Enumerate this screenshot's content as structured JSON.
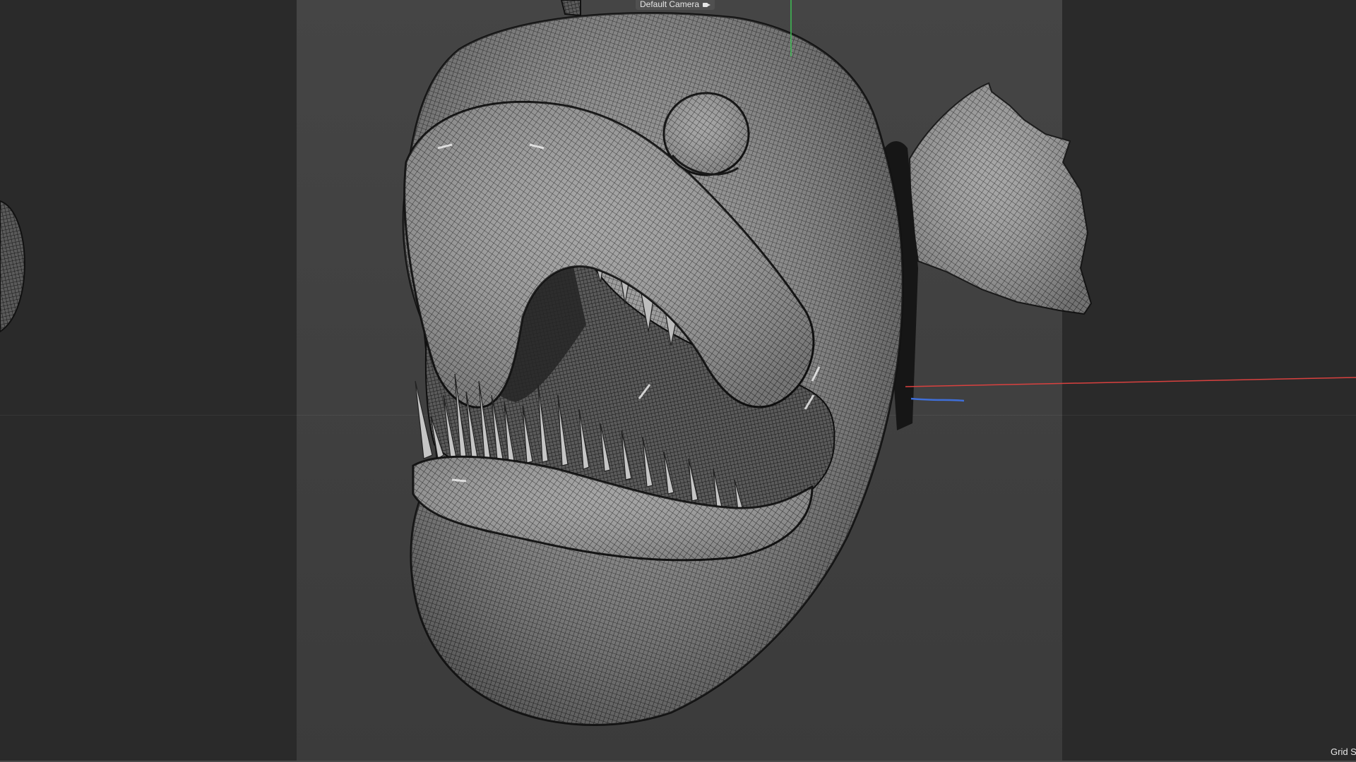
{
  "viewport": {
    "camera_label": "Default Camera",
    "camera_icon": "camera-icon",
    "grid_label": "Grid S"
  },
  "colors": {
    "background": "#2b2b2b",
    "render_region": "#444444",
    "axis_x": "#d9413f",
    "axis_y": "#3fbf55",
    "axis_z": "#3f6fd9",
    "wireframe": "#111111"
  }
}
